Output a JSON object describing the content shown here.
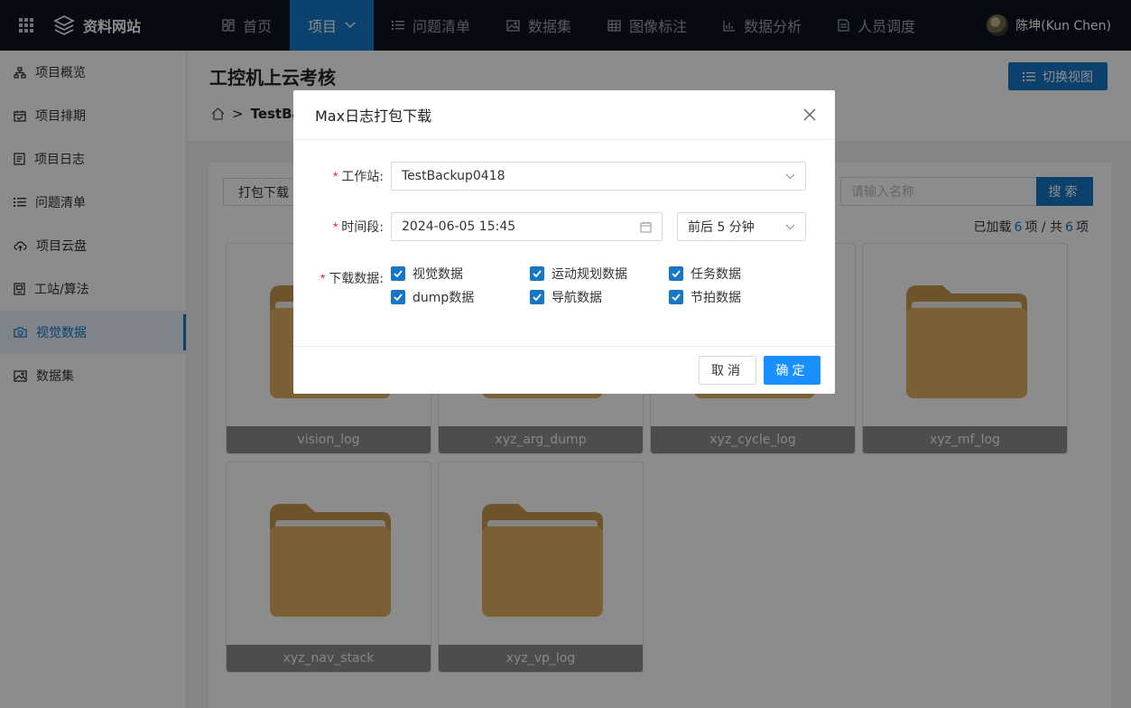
{
  "brand": {
    "name": "资料网站"
  },
  "nav": {
    "items": [
      {
        "label": "首页",
        "icon": "dashboard-icon"
      },
      {
        "label": "项目",
        "icon": "chevron-down-icon"
      },
      {
        "label": "问题清单",
        "icon": "list-icon"
      },
      {
        "label": "数据集",
        "icon": "image-icon"
      },
      {
        "label": "图像标注",
        "icon": "table-icon"
      },
      {
        "label": "数据分析",
        "icon": "bar-chart-icon"
      },
      {
        "label": "人员调度",
        "icon": "document-icon"
      }
    ],
    "active_index": 1
  },
  "user": {
    "name": "陈坤(Kun Chen)"
  },
  "sidebar": {
    "items": [
      {
        "label": "项目概览",
        "icon": "sitemap-icon"
      },
      {
        "label": "项目排期",
        "icon": "calendar-icon"
      },
      {
        "label": "项目日志",
        "icon": "file-text-icon"
      },
      {
        "label": "问题清单",
        "icon": "list-icon"
      },
      {
        "label": "项目云盘",
        "icon": "cloud-upload-icon"
      },
      {
        "label": "工站/算法",
        "icon": "device-icon"
      },
      {
        "label": "视觉数据",
        "icon": "camera-icon"
      },
      {
        "label": "数据集",
        "icon": "image-icon"
      }
    ],
    "active_index": 6
  },
  "header": {
    "title": "工控机上云考核",
    "switch_view": "切换视图",
    "breadcrumb_sep": ">",
    "breadcrumb_current": "TestBackup0418"
  },
  "toolbar": {
    "pack_download": "打包下载",
    "search_placeholder": "请输入名称",
    "search_button": "搜索",
    "count_prefix": "已加载",
    "count_loaded": "6",
    "count_mid": "项 / 共",
    "count_total": "6",
    "count_suffix": "项"
  },
  "folders": [
    {
      "name": "vision_log"
    },
    {
      "name": "xyz_arg_dump"
    },
    {
      "name": "xyz_cycle_log"
    },
    {
      "name": "xyz_mf_log"
    },
    {
      "name": "xyz_nav_stack"
    },
    {
      "name": "xyz_vp_log"
    }
  ],
  "modal": {
    "title": "Max日志打包下载",
    "station_label": "工作站",
    "station_value": "TestBackup0418",
    "period_label": "时间段",
    "period_value": "2024-06-05 15:45",
    "range_value": "前后 5 分钟",
    "download_label": "下载数据",
    "options": [
      {
        "label": "视觉数据",
        "checked": true
      },
      {
        "label": "运动规划数据",
        "checked": true
      },
      {
        "label": "任务数据",
        "checked": true
      },
      {
        "label": "dump数据",
        "checked": true
      },
      {
        "label": "导航数据",
        "checked": true
      },
      {
        "label": "节拍数据",
        "checked": true
      }
    ],
    "cancel": "取消",
    "ok": "确定"
  },
  "colors": {
    "primary": "#1677c8",
    "ok_button": "#1890ff",
    "nav_bg": "#0b1524",
    "folder": "#e0b061",
    "required": "#f5222d"
  }
}
